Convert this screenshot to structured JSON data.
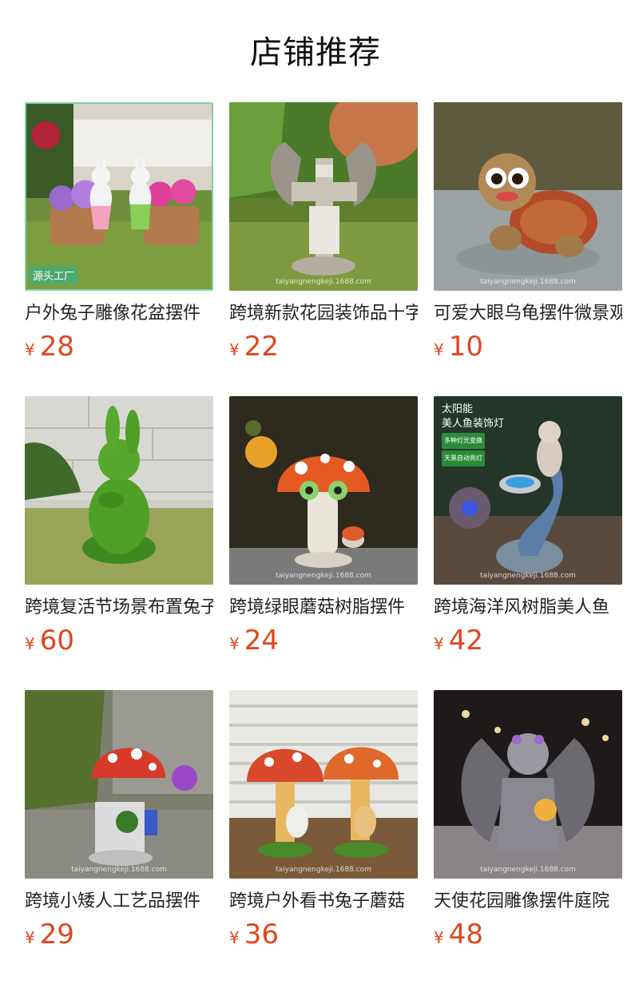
{
  "page": {
    "title": "店铺推荐"
  },
  "currency": "¥",
  "products": [
    {
      "name": "户外兔子雕像花盆摆件",
      "price": "28",
      "image": "rabbit-flowerpot-photo",
      "badge": "源头工厂"
    },
    {
      "name": "跨境新款花园装饰品十字架",
      "price": "22",
      "image": "cross-angel-wings-photo"
    },
    {
      "name": "可爱大眼乌龟摆件微景观",
      "price": "10",
      "image": "turtle-figurine-photo"
    },
    {
      "name": "跨境复活节场景布置兔子",
      "price": "60",
      "image": "moss-rabbit-photo"
    },
    {
      "name": "跨境绿眼蘑菇树脂摆件",
      "price": "24",
      "image": "green-eye-mushroom-photo"
    },
    {
      "name": "跨境海洋风树脂美人鱼",
      "price": "42",
      "image": "mermaid-solar-lamp-photo",
      "ad_title": "太阳能",
      "ad_subtitle": "美人鱼装饰灯",
      "ad_tag1": "多种灯光变换",
      "ad_tag2": "天黑自动亮灯"
    },
    {
      "name": "跨境小矮人工艺品摆件",
      "price": "29",
      "image": "gnome-mushroom-photo"
    },
    {
      "name": "跨境户外看书兔子蘑菇",
      "price": "36",
      "image": "reading-rabbit-mushroom-photo"
    },
    {
      "name": "天使花园雕像摆件庭院",
      "price": "48",
      "image": "angel-statue-photo"
    }
  ],
  "watermark": "taiyangnengkeji.1688.com"
}
